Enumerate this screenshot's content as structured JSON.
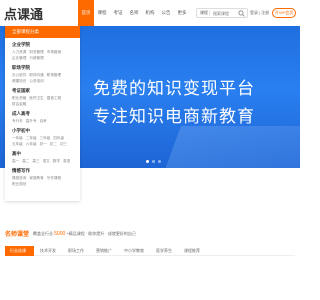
{
  "header": {
    "logo_text": "点课通",
    "nav": [
      "首页",
      "课程",
      "考证",
      "名师",
      "机构",
      "公告",
      "更多"
    ],
    "search": {
      "scope": "课程",
      "placeholder": "搜索课程"
    },
    "auth": "登录 | 注册",
    "vip": "开VIP会员"
  },
  "category_menu": {
    "heading": "全部课程分类",
    "groups": [
      {
        "title": "企业学院",
        "subs": [
          "人力资源",
          "财务管理",
          "市场营销",
          "企业管理",
          "行政管理"
        ]
      },
      {
        "title": "职场学院",
        "subs": [
          "办公软件",
          "职场沟通",
          "职场管理",
          "健康知识",
          "公务培训"
        ]
      },
      {
        "title": "考证国家",
        "subs": [
          "职业资格",
          "医药卫生",
          "建造工程",
          "财会金融"
        ]
      },
      {
        "title": "成人高考",
        "subs": [
          "专升本",
          "高升专",
          "自考"
        ]
      },
      {
        "title": "小学初中",
        "subs": [
          "一年级",
          "二年级",
          "三年级",
          "四年级",
          "五年级",
          "六年级",
          "初一",
          "初二",
          "初三"
        ]
      },
      {
        "title": "高中",
        "subs": [
          "高一",
          "高二",
          "高三",
          "语文",
          "数学",
          "英语"
        ]
      },
      {
        "title": "情感写作",
        "subs": [
          "情感咨询",
          "家庭教育",
          "写作课程",
          "职业规划"
        ]
      }
    ]
  },
  "banner": {
    "title": "免费的知识变现平台",
    "subtitle": "专注知识电商新教育",
    "slide_count": 3,
    "active_slide": 0
  },
  "notice": {
    "title": "名师课堂",
    "text_prefix": "覆盖全行业",
    "count": "5000",
    "text_suffix": "+精品课程 · 助你提升 · 成就更好的自己"
  },
  "tabs": {
    "items": [
      "行业选课",
      "技术开发",
      "职场工作",
      "营销推广",
      "中小学教育",
      "医学养生",
      "课程推荐"
    ],
    "active": 0
  },
  "colors": {
    "accent": "#ff6a00",
    "banner_blue": "#2a7ff0"
  }
}
